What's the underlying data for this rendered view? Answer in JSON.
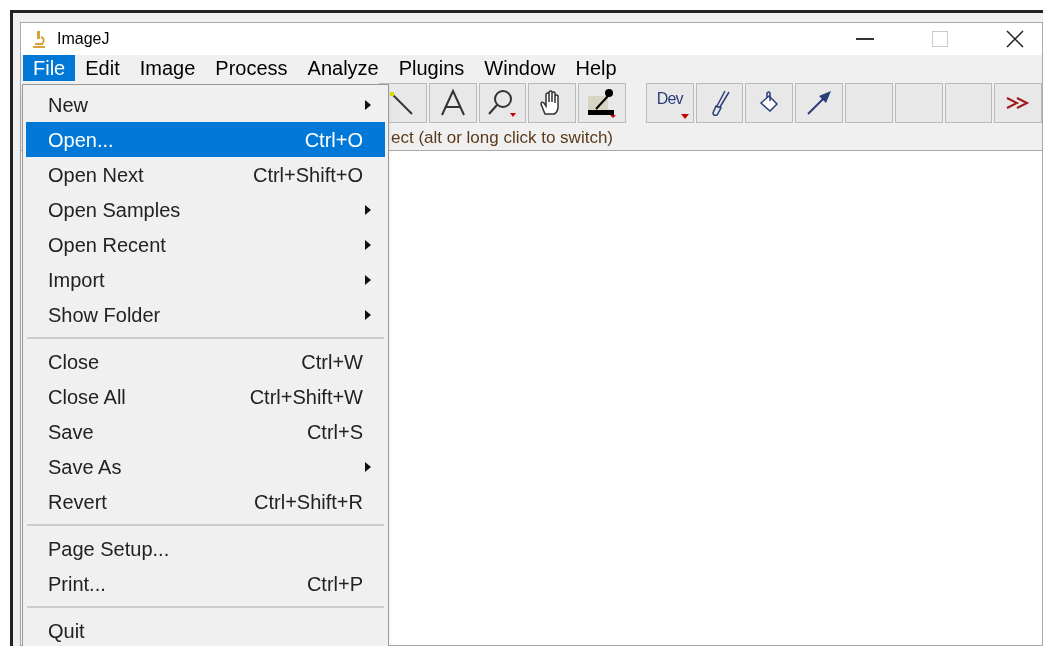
{
  "window": {
    "title": "ImageJ"
  },
  "menu_bar": [
    {
      "label": "File",
      "selected": true
    },
    {
      "label": "Edit",
      "selected": false
    },
    {
      "label": "Image",
      "selected": false
    },
    {
      "label": "Process",
      "selected": false
    },
    {
      "label": "Analyze",
      "selected": false
    },
    {
      "label": "Plugins",
      "selected": false
    },
    {
      "label": "Window",
      "selected": false
    },
    {
      "label": "Help",
      "selected": false
    }
  ],
  "toolbar": [
    {
      "kind": "line",
      "selected": false
    },
    {
      "kind": "text",
      "selected": false
    },
    {
      "kind": "magnifier",
      "selected": false
    },
    {
      "kind": "hand",
      "selected": false
    },
    {
      "kind": "picker",
      "selected": false
    },
    {
      "kind": "gap"
    },
    {
      "kind": "dev",
      "label": "Dev",
      "selected": false
    },
    {
      "kind": "brush",
      "selected": false
    },
    {
      "kind": "fill",
      "selected": false
    },
    {
      "kind": "arrow",
      "selected": false
    },
    {
      "kind": "empty",
      "selected": false
    },
    {
      "kind": "empty",
      "selected": false
    },
    {
      "kind": "empty",
      "selected": false
    },
    {
      "kind": "more",
      "selected": false
    }
  ],
  "status_bar": "ect (alt or long click to switch)",
  "file_menu": [
    {
      "kind": "submenu",
      "label": "New",
      "selected": false
    },
    {
      "kind": "command",
      "label": "Open...",
      "shortcut": "Ctrl+O",
      "selected": true
    },
    {
      "kind": "command",
      "label": "Open Next",
      "shortcut": "Ctrl+Shift+O",
      "selected": false
    },
    {
      "kind": "submenu",
      "label": "Open Samples",
      "selected": false
    },
    {
      "kind": "submenu",
      "label": "Open Recent",
      "selected": false
    },
    {
      "kind": "submenu",
      "label": "Import",
      "selected": false
    },
    {
      "kind": "submenu",
      "label": "Show Folder",
      "selected": false
    },
    {
      "kind": "separator"
    },
    {
      "kind": "command",
      "label": "Close",
      "shortcut": "Ctrl+W",
      "selected": false
    },
    {
      "kind": "command",
      "label": "Close All",
      "shortcut": "Ctrl+Shift+W",
      "selected": false
    },
    {
      "kind": "command",
      "label": "Save",
      "shortcut": "Ctrl+S",
      "selected": false
    },
    {
      "kind": "submenu",
      "label": "Save As",
      "selected": false
    },
    {
      "kind": "command",
      "label": "Revert",
      "shortcut": "Ctrl+Shift+R",
      "selected": false
    },
    {
      "kind": "separator"
    },
    {
      "kind": "command",
      "label": "Page Setup...",
      "selected": false
    },
    {
      "kind": "command",
      "label": "Print...",
      "shortcut": "Ctrl+P",
      "selected": false
    },
    {
      "kind": "separator"
    },
    {
      "kind": "command",
      "label": "Quit",
      "selected": false
    }
  ]
}
